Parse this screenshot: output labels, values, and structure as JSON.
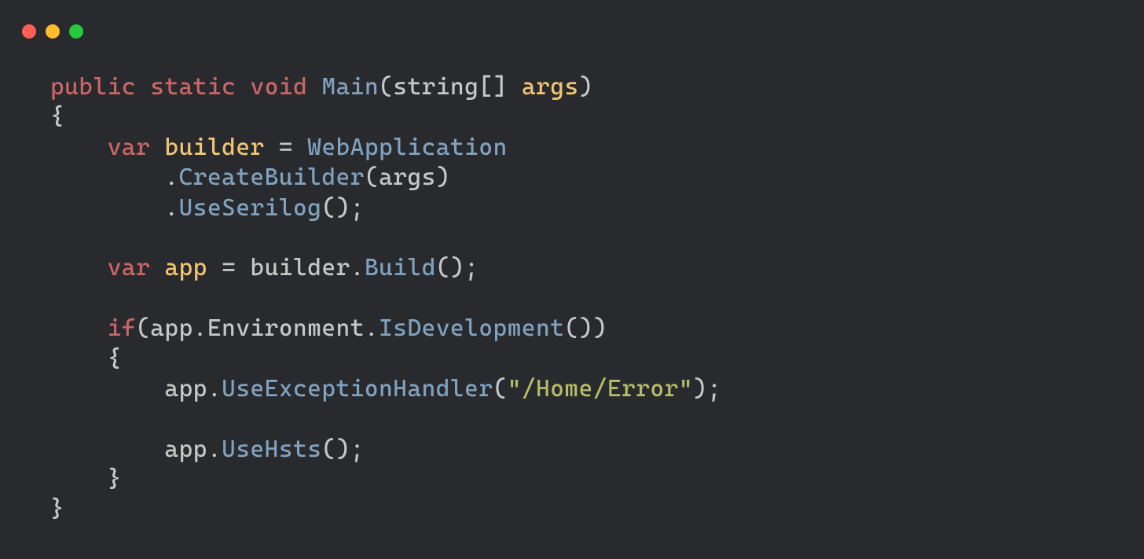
{
  "window": {
    "traffic_lights": [
      "red",
      "yellow",
      "green"
    ]
  },
  "code": {
    "tokens": [
      [
        {
          "t": "public",
          "c": "kw"
        },
        {
          "t": " ",
          "c": "plain"
        },
        {
          "t": "static",
          "c": "kw"
        },
        {
          "t": " ",
          "c": "plain"
        },
        {
          "t": "void",
          "c": "kw"
        },
        {
          "t": " ",
          "c": "plain"
        },
        {
          "t": "Main",
          "c": "fn"
        },
        {
          "t": "(",
          "c": "pn"
        },
        {
          "t": "string",
          "c": "plain"
        },
        {
          "t": "[] ",
          "c": "pn"
        },
        {
          "t": "args",
          "c": "id"
        },
        {
          "t": ")",
          "c": "pn"
        }
      ],
      [
        {
          "t": "{",
          "c": "pn"
        }
      ],
      [
        {
          "t": "    ",
          "c": "plain"
        },
        {
          "t": "var",
          "c": "kw"
        },
        {
          "t": " ",
          "c": "plain"
        },
        {
          "t": "builder",
          "c": "id"
        },
        {
          "t": " ",
          "c": "plain"
        },
        {
          "t": "=",
          "c": "op"
        },
        {
          "t": " ",
          "c": "plain"
        },
        {
          "t": "WebApplication",
          "c": "type"
        }
      ],
      [
        {
          "t": "        .",
          "c": "pn"
        },
        {
          "t": "CreateBuilder",
          "c": "call"
        },
        {
          "t": "(",
          "c": "pn"
        },
        {
          "t": "args",
          "c": "plain"
        },
        {
          "t": ")",
          "c": "pn"
        }
      ],
      [
        {
          "t": "        .",
          "c": "pn"
        },
        {
          "t": "UseSerilog",
          "c": "call"
        },
        {
          "t": "();",
          "c": "pn"
        }
      ],
      [
        {
          "t": "",
          "c": "plain"
        }
      ],
      [
        {
          "t": "    ",
          "c": "plain"
        },
        {
          "t": "var",
          "c": "kw"
        },
        {
          "t": " ",
          "c": "plain"
        },
        {
          "t": "app",
          "c": "id"
        },
        {
          "t": " ",
          "c": "plain"
        },
        {
          "t": "=",
          "c": "op"
        },
        {
          "t": " builder.",
          "c": "plain"
        },
        {
          "t": "Build",
          "c": "call"
        },
        {
          "t": "();",
          "c": "pn"
        }
      ],
      [
        {
          "t": "",
          "c": "plain"
        }
      ],
      [
        {
          "t": "    ",
          "c": "plain"
        },
        {
          "t": "if",
          "c": "kw"
        },
        {
          "t": "(app.Environment.",
          "c": "plain"
        },
        {
          "t": "IsDevelopment",
          "c": "call"
        },
        {
          "t": "())",
          "c": "pn"
        }
      ],
      [
        {
          "t": "    {",
          "c": "pn"
        }
      ],
      [
        {
          "t": "        app.",
          "c": "plain"
        },
        {
          "t": "UseExceptionHandler",
          "c": "call"
        },
        {
          "t": "(",
          "c": "pn"
        },
        {
          "t": "\"/Home/Error\"",
          "c": "str"
        },
        {
          "t": ");",
          "c": "pn"
        }
      ],
      [
        {
          "t": "",
          "c": "plain"
        }
      ],
      [
        {
          "t": "        app.",
          "c": "plain"
        },
        {
          "t": "UseHsts",
          "c": "call"
        },
        {
          "t": "();",
          "c": "pn"
        }
      ],
      [
        {
          "t": "    }",
          "c": "pn"
        }
      ],
      [
        {
          "t": "}",
          "c": "pn"
        }
      ]
    ]
  },
  "colors": {
    "background": "#282a2e",
    "red": "#ff5f56",
    "yellow": "#ffbd2e",
    "green": "#27c93f",
    "keyword": "#cc6666",
    "function": "#81a2be",
    "identifier": "#f0c674",
    "string": "#b5bd68",
    "plain": "#c5c8c6"
  }
}
